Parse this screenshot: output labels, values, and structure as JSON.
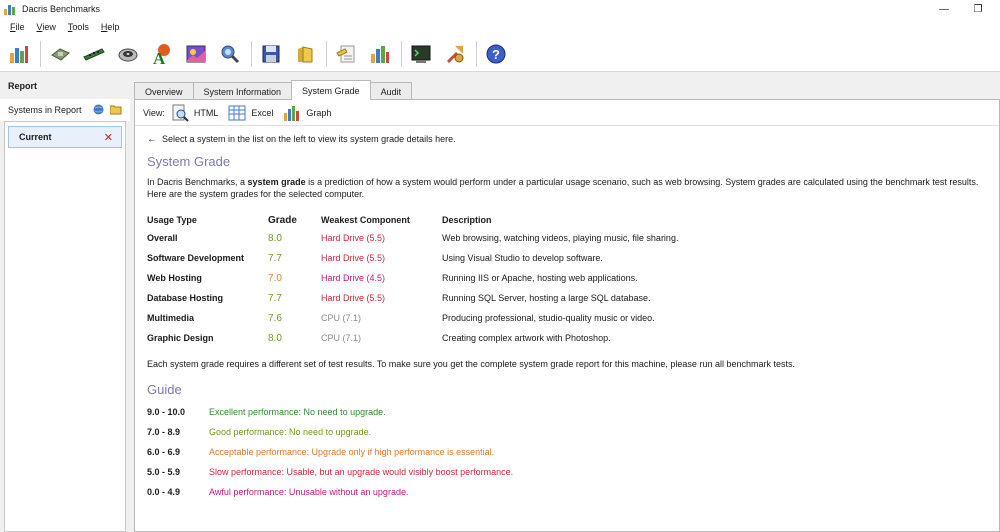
{
  "window": {
    "title": "Dacris Benchmarks",
    "minimize_glyph": "—",
    "restore_glyph": "❐"
  },
  "menu": {
    "items": [
      {
        "key": "F",
        "rest": "ile"
      },
      {
        "key": "V",
        "rest": "iew"
      },
      {
        "key": "T",
        "rest": "ools"
      },
      {
        "key": "H",
        "rest": "elp"
      }
    ]
  },
  "toolbar": {
    "icons": [
      "benchmark-icon",
      "cpu-icon",
      "memory-icon",
      "hard-drive-icon",
      "font-icon",
      "graphics-icon",
      "network-icon",
      "save-icon",
      "open-folder-icon",
      "notes-icon",
      "chart-icon",
      "terminal-icon",
      "tools-icon",
      "help-icon"
    ]
  },
  "sidebar": {
    "header": "Report",
    "sub_label": "Systems in Report",
    "items": [
      {
        "label": "Current",
        "remove_glyph": "✕"
      }
    ]
  },
  "tabs": [
    {
      "label": "Overview",
      "active": false
    },
    {
      "label": "System Information",
      "active": false
    },
    {
      "label": "System Grade",
      "active": true
    },
    {
      "label": "Audit",
      "active": false
    }
  ],
  "viewbar": {
    "label": "View:",
    "html": "HTML",
    "excel": "Excel",
    "graph": "Graph"
  },
  "content": {
    "hint": "Select a system in the list on the left to view its system grade details here.",
    "section_title": "System Grade",
    "intro_pre": "In Dacris Benchmarks, a ",
    "intro_bold": "system grade",
    "intro_post": " is a prediction of how a system would perform under a particular usage scenario, such as web browsing. System grades are calculated using the benchmark test results. Here are the system grades for the selected computer.",
    "table_headers": [
      "Usage Type",
      "Grade",
      "Weakest Component",
      "Description"
    ],
    "rows": [
      {
        "usage": "Overall",
        "grade": "8.0",
        "grade_color": "#6b9a1f",
        "weakest": "Hard Drive (5.5)",
        "weakest_color": "#d0273a",
        "description": "Web browsing, watching videos, playing music, file sharing."
      },
      {
        "usage": "Software Development",
        "grade": "7.7",
        "grade_color": "#6b9a1f",
        "weakest": "Hard Drive (5.5)",
        "weakest_color": "#d0273a",
        "description": "Using Visual Studio to develop software."
      },
      {
        "usage": "Web Hosting",
        "grade": "7.0",
        "grade_color": "#d9822b",
        "weakest": "Hard Drive (4.5)",
        "weakest_color": "#c5187a",
        "description": "Running IIS or Apache, hosting web applications."
      },
      {
        "usage": "Database Hosting",
        "grade": "7.7",
        "grade_color": "#6b9a1f",
        "weakest": "Hard Drive (5.5)",
        "weakest_color": "#d0273a",
        "description": "Running SQL Server, hosting a large SQL database."
      },
      {
        "usage": "Multimedia",
        "grade": "7.6",
        "grade_color": "#6b9a1f",
        "weakest": "CPU (7.1)",
        "weakest_color": "#8a8a8a",
        "description": "Producing professional, studio-quality music or video."
      },
      {
        "usage": "Graphic Design",
        "grade": "8.0",
        "grade_color": "#6b9a1f",
        "weakest": "CPU (7.1)",
        "weakest_color": "#8a8a8a",
        "description": "Creating complex artwork with Photoshop."
      }
    ],
    "footnote": "Each system grade requires a different set of test results. To make sure you get the complete system grade report for this machine, please run all benchmark tests.",
    "guide_title": "Guide",
    "guide": [
      {
        "range": "9.0 - 10.0",
        "text": "Excellent performance: No need to upgrade.",
        "color": "#2e8b2e"
      },
      {
        "range": "7.0 - 8.9",
        "text": "Good performance: No need to upgrade.",
        "color": "#6b9a1f"
      },
      {
        "range": "6.0 - 6.9",
        "text": "Acceptable performance: Upgrade only if high performance is essential.",
        "color": "#e0782a"
      },
      {
        "range": "5.0 - 5.9",
        "text": "Slow performance: Usable, but an upgrade would visibly boost performance.",
        "color": "#d0273a"
      },
      {
        "range": "0.0 - 4.9",
        "text": "Awful performance: Unusable without an upgrade.",
        "color": "#c5187a"
      }
    ]
  }
}
